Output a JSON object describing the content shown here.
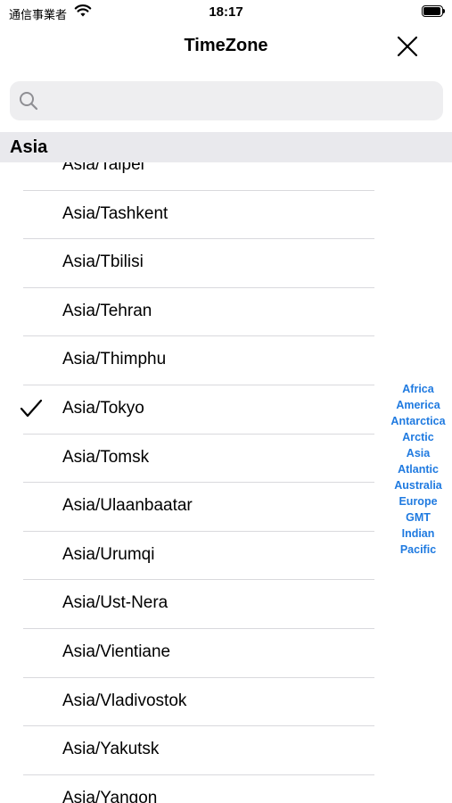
{
  "status_bar": {
    "carrier": "通信事業者",
    "time": "18:17"
  },
  "nav": {
    "title": "TimeZone",
    "close_icon": "close-icon"
  },
  "search": {
    "placeholder": "",
    "value": ""
  },
  "section": {
    "header": "Asia"
  },
  "rows": [
    {
      "label": "Asia/Taipei",
      "checked": false
    },
    {
      "label": "Asia/Tashkent",
      "checked": false
    },
    {
      "label": "Asia/Tbilisi",
      "checked": false
    },
    {
      "label": "Asia/Tehran",
      "checked": false
    },
    {
      "label": "Asia/Thimphu",
      "checked": false
    },
    {
      "label": "Asia/Tokyo",
      "checked": true
    },
    {
      "label": "Asia/Tomsk",
      "checked": false
    },
    {
      "label": "Asia/Ulaanbaatar",
      "checked": false
    },
    {
      "label": "Asia/Urumqi",
      "checked": false
    },
    {
      "label": "Asia/Ust-Nera",
      "checked": false
    },
    {
      "label": "Asia/Vientiane",
      "checked": false
    },
    {
      "label": "Asia/Vladivostok",
      "checked": false
    },
    {
      "label": "Asia/Yakutsk",
      "checked": false
    },
    {
      "label": "Asia/Yangon",
      "checked": false
    }
  ],
  "section_index": [
    "Africa",
    "America",
    "Antarctica",
    "Arctic",
    "Asia",
    "Atlantic",
    "Australia",
    "Europe",
    "GMT",
    "Indian",
    "Pacific"
  ],
  "colors": {
    "accent": "#1f7ae0",
    "header_bg": "#e9e9ed",
    "search_bg": "#eeeef0"
  }
}
